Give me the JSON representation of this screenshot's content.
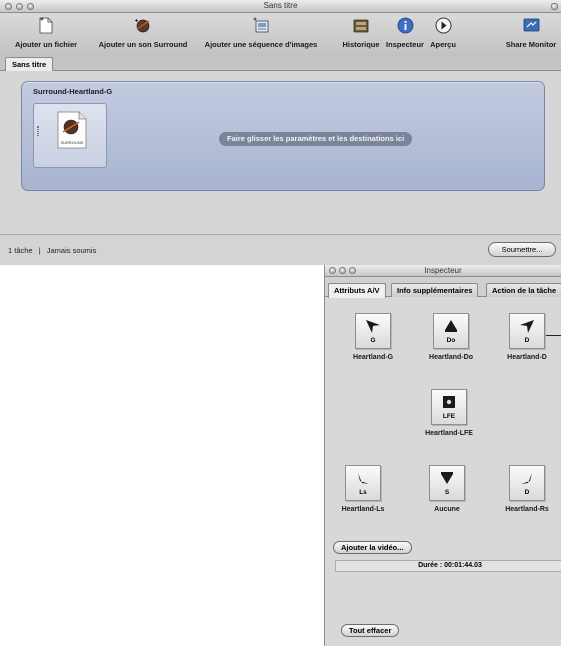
{
  "main_window": {
    "title": "Sans titre",
    "toolbar": [
      {
        "label": "Ajouter un fichier",
        "icon": "add-file-icon"
      },
      {
        "label": "Ajouter un son Surround",
        "icon": "add-surround-icon"
      },
      {
        "label": "Ajouter une séquence d'images",
        "icon": "add-image-sequence-icon"
      },
      {
        "label": "Historique",
        "icon": "history-icon"
      },
      {
        "label": "Inspecteur",
        "icon": "info-icon"
      },
      {
        "label": "Aperçu",
        "icon": "play-icon"
      },
      {
        "label": "Share Monitor",
        "icon": "share-monitor-icon"
      }
    ],
    "tab": "Sans titre",
    "job": {
      "title": "Surround-Heartland-G",
      "file_icon_label": "SURROUND",
      "drop_hint": "Faire glisser les paramètres et les destinations ici"
    },
    "status": {
      "count": "1 tâche",
      "separator": "|",
      "state": "Jamais soumis",
      "submit_label": "Soumettre..."
    }
  },
  "inspector": {
    "title": "Inspecteur",
    "tabs": [
      "Attributs A/V",
      "Info supplémentaires",
      "Action de la tâche"
    ],
    "speakers": [
      {
        "channel": "G",
        "source": "Heartland-G"
      },
      {
        "channel": "Do",
        "source": "Heartland-Do"
      },
      {
        "channel": "D",
        "source": "Heartland-D"
      },
      {
        "channel": "LFE",
        "source": "Heartland-LFE"
      },
      {
        "channel": "Ls",
        "source": "Heartland-Ls"
      },
      {
        "channel": "S",
        "source": "Aucune"
      },
      {
        "channel": "D",
        "source": "Heartland-Rs"
      }
    ],
    "add_video_label": "Ajouter la vidéo...",
    "duration": "Durée : 00:01:44.03",
    "clear_all_label": "Tout effacer"
  },
  "colors": {
    "job_panel": "#b4bed8",
    "drop_hint_bg": "#7b849a",
    "window_bg": "#d8d8d8"
  }
}
